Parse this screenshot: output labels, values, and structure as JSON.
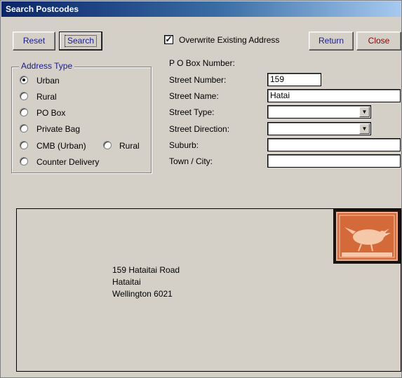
{
  "window": {
    "title": "Search Postcodes"
  },
  "toolbar": {
    "reset_label": "Reset",
    "search_label": "Search",
    "overwrite_label": "Overwrite Existing Address",
    "overwrite_checked": "✓",
    "return_label": "Return",
    "close_label": "Close"
  },
  "address_type": {
    "title": "Address Type",
    "options": [
      "Urban",
      "Rural",
      "PO Box",
      "Private Bag",
      "CMB (Urban)",
      "Rural",
      "Counter Delivery"
    ],
    "selected": "Urban"
  },
  "form": {
    "po_box_label": "P O Box Number:",
    "street_number_label": "Street Number:",
    "street_number_value": "159",
    "street_name_label": "Street Name:",
    "street_name_value": "Hatai",
    "street_type_label": "Street Type:",
    "street_type_value": "",
    "street_direction_label": "Street Direction:",
    "street_direction_value": "",
    "suburb_label": "Suburb:",
    "suburb_value": "",
    "town_label": "Town / City:",
    "town_value": ""
  },
  "envelope": {
    "lines": [
      "159 Hataitai Road",
      "Hataitai",
      "Wellington 6021"
    ]
  },
  "colors": {
    "stamp": "#d46a3a",
    "title_gradient_start": "#0a246a",
    "button_text": "#1a1a8c",
    "close_text": "#8b0000"
  }
}
